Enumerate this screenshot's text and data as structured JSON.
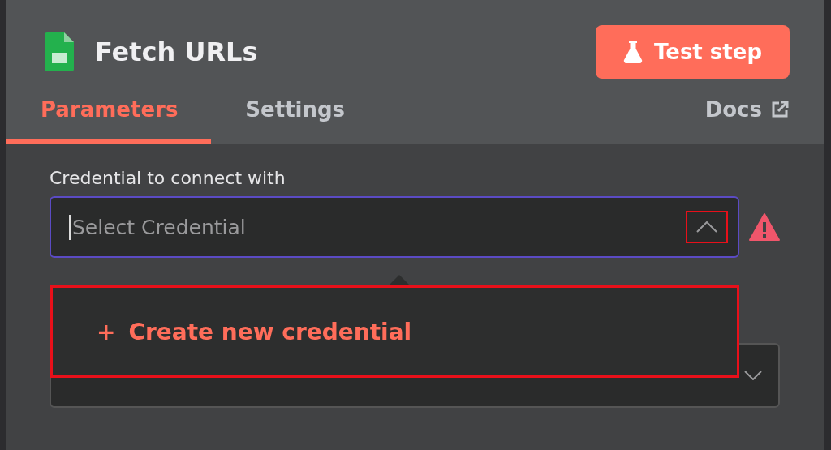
{
  "node": {
    "title": "Fetch URLs"
  },
  "test_button": {
    "label": "Test step"
  },
  "tabs": [
    {
      "label": "Parameters",
      "selected": true
    },
    {
      "label": "Settings",
      "selected": false
    }
  ],
  "docs_link": {
    "label": "Docs"
  },
  "credential": {
    "label": "Credential to connect with",
    "placeholder": "Select Credential",
    "expanded": true,
    "warning": true,
    "toggle_highlighted": true
  },
  "dropdown": {
    "items": [
      {
        "icon": "+",
        "label": "Create new credential",
        "highlighted": true
      }
    ]
  }
}
